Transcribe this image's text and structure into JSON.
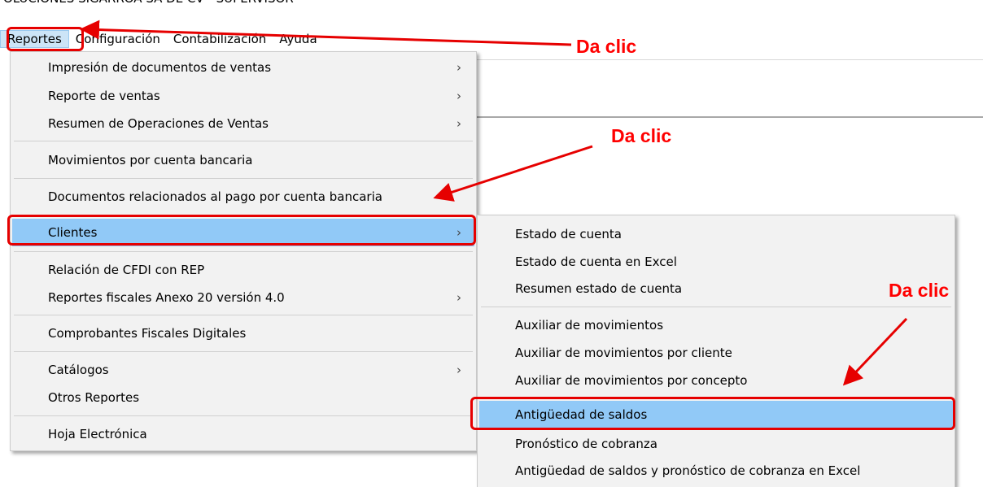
{
  "window": {
    "title": "OLUCIONES SIGARROA SA DE CV  -  SUPERVISOR"
  },
  "menubar": {
    "items": [
      "Reportes",
      "Configuración",
      "Contabilización",
      "Ayuda"
    ]
  },
  "reportes_menu": {
    "items": [
      "Impresión de documentos de ventas",
      "Reporte de ventas",
      "Resumen de Operaciones de Ventas",
      "Movimientos por cuenta bancaria",
      "Documentos relacionados al pago por cuenta bancaria",
      "Clientes",
      "Relación de CFDI con REP",
      "Reportes fiscales Anexo 20 versión 4.0",
      "Comprobantes Fiscales Digitales",
      "Catálogos",
      "Otros Reportes",
      "Hoja Electrónica"
    ],
    "submenu_chevron": "›",
    "highlighted": "Clientes"
  },
  "clientes_submenu": {
    "items": [
      "Estado de cuenta",
      "Estado de cuenta en Excel",
      "Resumen estado de cuenta",
      "Auxiliar de movimientos",
      "Auxiliar de movimientos por cliente",
      "Auxiliar de movimientos por concepto",
      "Antigüedad de saldos",
      "Pronóstico de cobranza",
      "Antigüedad de saldos y pronóstico de cobranza en Excel"
    ],
    "highlighted": "Antigüedad de saldos"
  },
  "annotations": {
    "callout_1": "Da clic",
    "callout_2": "Da clic",
    "callout_3": "Da clic",
    "color": "#ff0000"
  },
  "colors": {
    "highlight": "#91c9f7",
    "menu_background": "#f2f2f2",
    "annotation_red": "#e60000"
  }
}
